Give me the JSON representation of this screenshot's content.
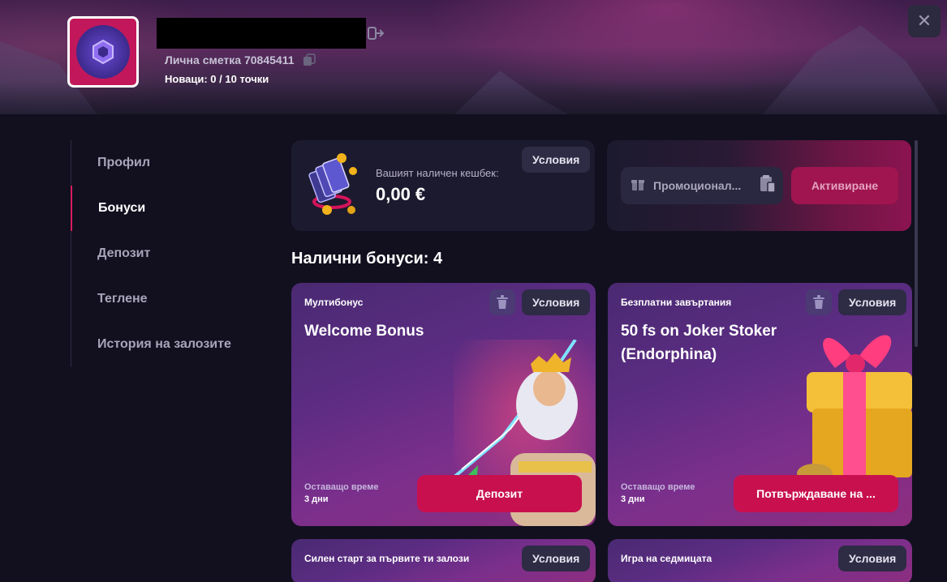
{
  "header": {
    "account_line": "Лична сметка 70845411",
    "points_line": "Новаци: 0  / 10 точки",
    "close_glyph": "✕"
  },
  "sidebar": {
    "items": [
      {
        "label": "Профил"
      },
      {
        "label": "Бонуси",
        "active": true
      },
      {
        "label": "Депозит"
      },
      {
        "label": "Теглене"
      },
      {
        "label": "История на залозите"
      }
    ]
  },
  "cashback": {
    "label": "Вашият наличен кешбек:",
    "value": "0,00 €",
    "terms": "Условия"
  },
  "promo": {
    "placeholder": "Промоционал...",
    "activate": "Активиране"
  },
  "bonuses": {
    "title": "Налични бонуси: 4",
    "cards": [
      {
        "type": "Мултибонус",
        "title": "Welcome Bonus",
        "terms": "Условия",
        "remaining_label": "Оставащо време",
        "remaining_value": "3 дни",
        "cta": "Депозит"
      },
      {
        "type": "Безплатни завъртания",
        "title": "50 fs on Joker Stoker (Endorphina)",
        "terms": "Условия",
        "remaining_label": "Оставащо време",
        "remaining_value": "3 дни",
        "cta": "Потвърждаване на ..."
      },
      {
        "type": "Силен старт за първите ти залози",
        "terms": "Условия"
      },
      {
        "type": "Игра на седмицата",
        "terms": "Условия"
      }
    ]
  },
  "colors": {
    "accent": "#c8104f",
    "background": "#12101f",
    "card": "#1c1a2e"
  }
}
